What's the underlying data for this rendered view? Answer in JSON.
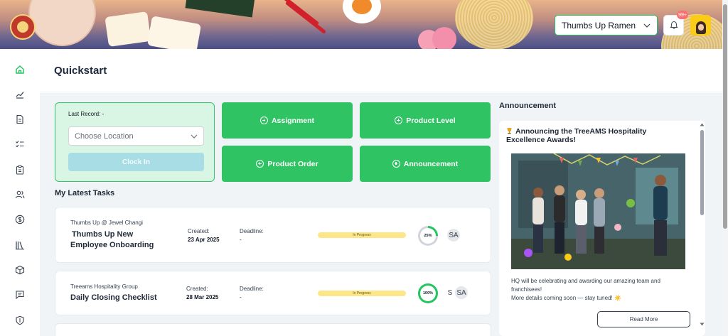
{
  "header": {
    "logo_text": "Thumbs Up Ramen",
    "location_selected": "Thumbs Up Ramen",
    "notification_count": "99+"
  },
  "sidebar": {
    "items": [
      {
        "name": "home",
        "icon": "home-icon"
      },
      {
        "name": "analytics",
        "icon": "chart-icon"
      },
      {
        "name": "documents",
        "icon": "document-icon"
      },
      {
        "name": "checklists",
        "icon": "checklist-icon"
      },
      {
        "name": "clipboard",
        "icon": "clipboard-icon"
      },
      {
        "name": "users",
        "icon": "users-icon"
      },
      {
        "name": "finance",
        "icon": "dollar-icon"
      },
      {
        "name": "library",
        "icon": "library-icon"
      },
      {
        "name": "products",
        "icon": "box-icon"
      },
      {
        "name": "messages",
        "icon": "message-icon"
      },
      {
        "name": "security",
        "icon": "shield-icon"
      }
    ]
  },
  "page": {
    "title": "Quickstart"
  },
  "clock": {
    "last_record": "Last Record: -",
    "location_placeholder": "Choose Location",
    "clock_in_label": "Clock In"
  },
  "actions": {
    "assignment": "Assignment",
    "product_level": "Product Level",
    "product_order": "Product Order",
    "announcement": "Announcement"
  },
  "tasks": {
    "section_title": "My Latest Tasks",
    "created_label": "Created:",
    "deadline_label": "Deadline:",
    "items": [
      {
        "org": "Thumbs Up @ Jewel Changi",
        "name": "Thumbs Up New Employee Onboarding",
        "created": "23 Apr 2025",
        "deadline": "-",
        "status": "In Progress",
        "progress": 25,
        "progress_text": "25%",
        "assignees": [
          "SA"
        ]
      },
      {
        "org": "Treeams Hospitality Group",
        "name": "Daily Closing Checklist",
        "created": "28 Mar 2025",
        "deadline": "-",
        "status": "In Progress",
        "progress": 100,
        "progress_text": "100%",
        "assignees": [
          "S",
          "SA"
        ]
      }
    ]
  },
  "announcement": {
    "section_title": "Announcement",
    "heading": "Announcing the TreeAMS Hospitality Excellence Awards!",
    "body_line1": "HQ will be celebrating and awarding our amazing team and franchisees!",
    "body_line2": "More details coming soon — stay tuned! ☀️",
    "read_more": "Read More"
  },
  "colors": {
    "accent": "#2fc363",
    "clock_card_bg": "#d9f5e4",
    "progress_ring": "#22c55e",
    "status_pill": "#fde68a"
  }
}
